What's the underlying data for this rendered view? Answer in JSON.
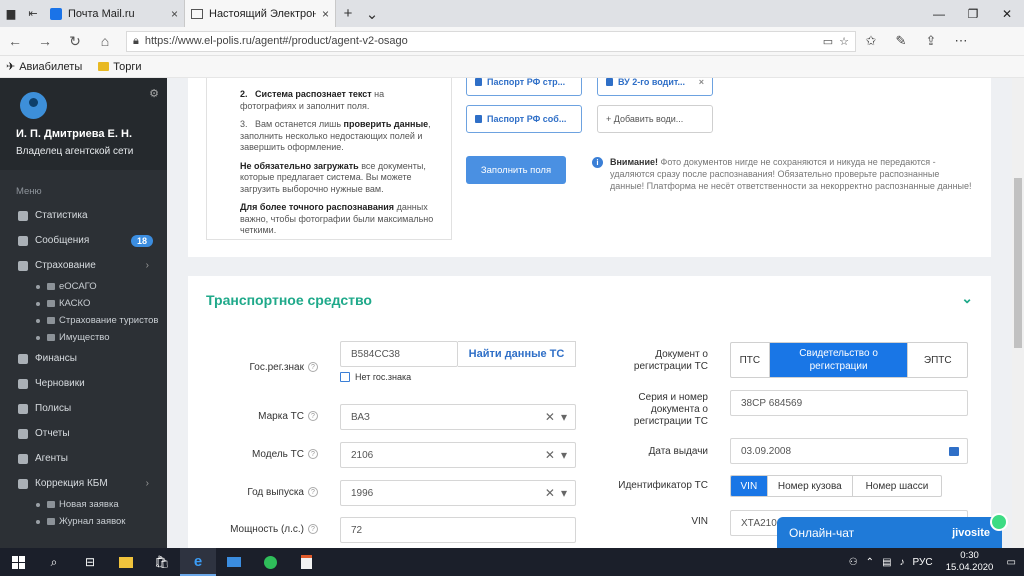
{
  "tabs": [
    {
      "label": "Почта Mail.ru"
    },
    {
      "label": "Настоящий Электронн"
    }
  ],
  "address": {
    "url": "https://www.el-polis.ru/agent#/product/agent-v2-osago"
  },
  "favorites": [
    {
      "label": "Авиабилеты"
    },
    {
      "label": "Торги"
    }
  ],
  "profile": {
    "name": "И. П. Дмитриева Е. Н.",
    "role": "Владелец агентской сети"
  },
  "menu": {
    "header": "Меню",
    "items": [
      {
        "label": "Статистика"
      },
      {
        "label": "Сообщения",
        "badge": "18"
      },
      {
        "label": "Страхование"
      },
      {
        "label": "Финансы"
      },
      {
        "label": "Черновики"
      },
      {
        "label": "Полисы"
      },
      {
        "label": "Отчеты"
      },
      {
        "label": "Агенты"
      },
      {
        "label": "Коррекция КБМ"
      }
    ],
    "insurance_sub": [
      {
        "label": "еОСАГО"
      },
      {
        "label": "КАСКО"
      },
      {
        "label": "Страхование туристов"
      },
      {
        "label": "Имущество"
      }
    ],
    "kbm_sub": [
      {
        "label": "Новая заявка"
      },
      {
        "label": "Журнал заявок"
      }
    ]
  },
  "instructions": {
    "step2_num": "2.",
    "step2_bold": "Система распознает текст",
    "step2_text": "на фотографиях и заполнит поля.",
    "step3_num": "3.",
    "step3_pre": "Вам останется лишь",
    "step3_bold": "проверить данные",
    "step3_text": ", заполнить несколько недостающих полей и завершить оформление.",
    "note1_bold": "Не обязательно загружать",
    "note1_text": "все документы, которые предлагает система. Вы можете загрузить выборочно нужные вам.",
    "note2_bold": "Для более точного распознавания",
    "note2_text": "данных важно, чтобы фотографии были максимально четкими."
  },
  "doc_buttons": {
    "passport1": "Паспорт РФ стр...",
    "vu": "ВУ 2-го водит...",
    "passport2": "Паспорт РФ соб...",
    "add": "+ Добавить води..."
  },
  "fill_button": "Заполнить поля",
  "warning": {
    "bold": "Внимание!",
    "text": "Фото документов нигде не сохраняются и никуда не передаются - удаляются сразу после распознавания! Обязательно проверьте распознанные данные! Платформа не несёт ответственности за некорректно распознанные данные!"
  },
  "vehicle": {
    "title": "Транспортное средство",
    "plate_label": "Гос.рег.знак",
    "plate_value": "В584СС38",
    "find_button": "Найти данные ТС",
    "no_plate": "Нет гос.знака",
    "brand_label": "Марка ТС",
    "brand_value": "ВАЗ",
    "model_label": "Модель ТС",
    "model_value": "2106",
    "year_label": "Год выпуска",
    "year_value": "1996",
    "power_label": "Мощность (л.с.)",
    "power_value": "72",
    "doc_label": "Документ о регистрации ТС",
    "doc_options": [
      "ПТС",
      "Свидетельство о регистрации",
      "ЭПТС"
    ],
    "series_label": "Серия и номер документа о регистрации ТС",
    "series_value": "38СР 684569",
    "issue_label": "Дата выдачи",
    "issue_value": "03.09.2008",
    "id_label": "Идентификатор ТС",
    "id_options": [
      "VIN",
      "Номер кузова",
      "Номер шасси"
    ],
    "vin_label": "VIN",
    "vin_value": "ХТА2106"
  },
  "chat": {
    "label": "Онлайн-чат",
    "brand": "jivosite"
  },
  "taskbar": {
    "lang": "РУС",
    "time": "0:30",
    "date": "15.04.2020"
  }
}
